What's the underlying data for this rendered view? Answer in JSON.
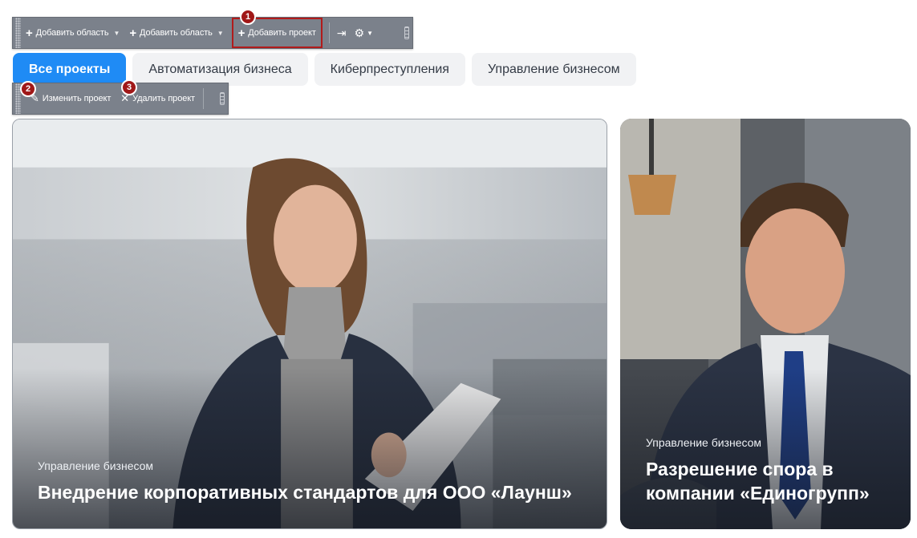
{
  "toolbar": {
    "add_area_1": "Добавить область",
    "add_area_2": "Добавить область",
    "add_project": "Добавить проект",
    "pin_icon": "pin-icon",
    "settings_icon": "gear-icon"
  },
  "badges": {
    "one": "1",
    "two": "2",
    "three": "3"
  },
  "tabs": [
    {
      "label": "Все проекты",
      "active": true
    },
    {
      "label": "Автоматизация бизнеса"
    },
    {
      "label": "Киберпреступления"
    },
    {
      "label": "Управление бизнесом"
    }
  ],
  "item_toolbar": {
    "edit": "Изменить проект",
    "delete": "Удалить проект"
  },
  "cards": [
    {
      "category": "Управление бизнесом",
      "title": "Внедрение корпоративных стандартов для ООО «Лаунш»"
    },
    {
      "category": "Управление бизнесом",
      "title": "Разрешение спора в компании «Единогрупп»"
    }
  ],
  "colors": {
    "accent": "#1f8bf5",
    "toolbar": "#7b818b",
    "badge": "#a01818"
  }
}
